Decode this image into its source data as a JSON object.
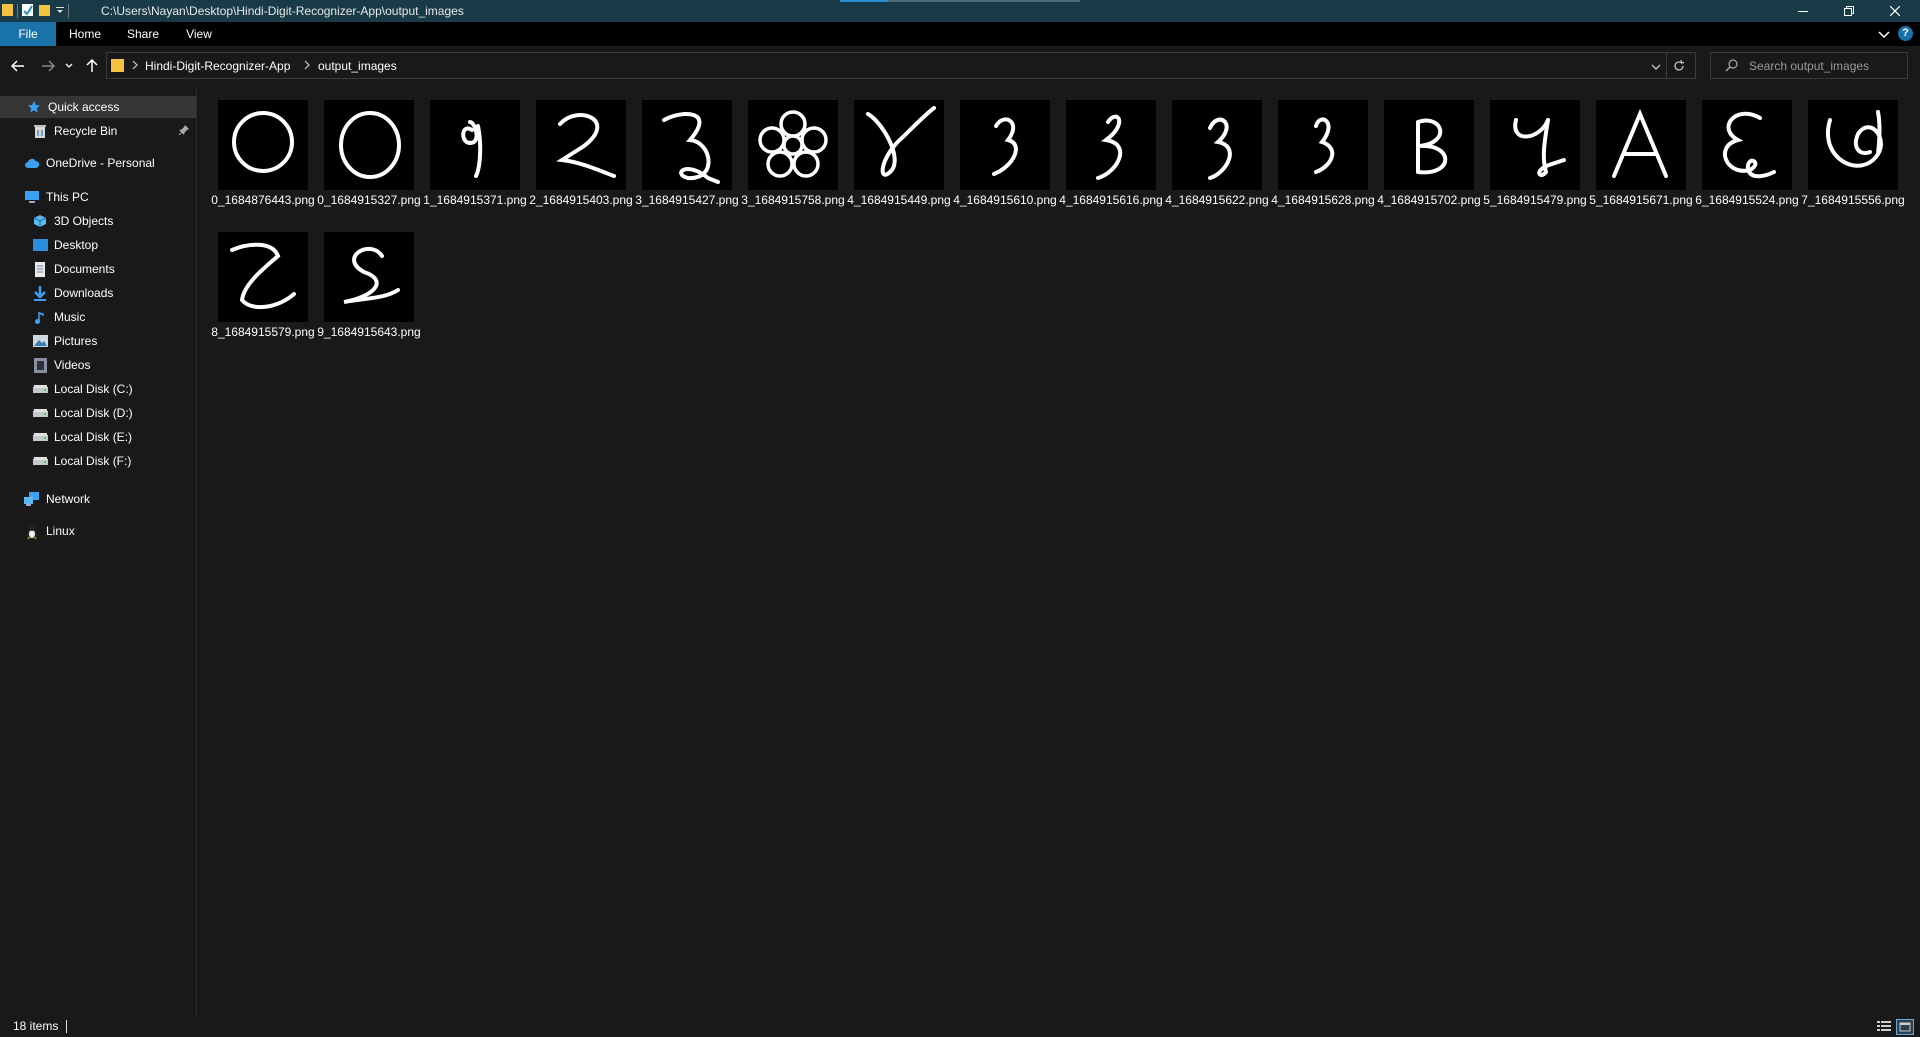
{
  "window": {
    "title": "C:\\Users\\Nayan\\Desktop\\Hindi-Digit-Recognizer-App\\output_images",
    "controls": [
      "minimize",
      "restore",
      "close"
    ]
  },
  "ribbon": {
    "tabs": [
      {
        "label": "File",
        "active": true
      },
      {
        "label": "Home"
      },
      {
        "label": "Share"
      },
      {
        "label": "View"
      }
    ]
  },
  "address": {
    "crumbs": [
      "Hindi-Digit-Recognizer-App",
      "output_images"
    ]
  },
  "search": {
    "placeholder": "Search output_images"
  },
  "sidebar": {
    "items": [
      {
        "label": "Quick access",
        "icon": "star-icon",
        "selected": true
      },
      {
        "label": "Recycle Bin",
        "icon": "recycle-bin-icon",
        "pinned": true
      },
      {
        "label": "OneDrive - Personal",
        "icon": "cloud-icon"
      },
      {
        "label": "This PC",
        "icon": "computer-icon"
      },
      {
        "label": "3D Objects",
        "icon": "cube-icon"
      },
      {
        "label": "Desktop",
        "icon": "desktop-icon"
      },
      {
        "label": "Documents",
        "icon": "document-icon"
      },
      {
        "label": "Downloads",
        "icon": "download-icon"
      },
      {
        "label": "Music",
        "icon": "music-icon"
      },
      {
        "label": "Pictures",
        "icon": "pictures-icon"
      },
      {
        "label": "Videos",
        "icon": "video-icon"
      },
      {
        "label": "Local Disk (C:)",
        "icon": "drive-icon"
      },
      {
        "label": "Local Disk (D:)",
        "icon": "drive-icon"
      },
      {
        "label": "Local Disk (E:)",
        "icon": "drive-icon"
      },
      {
        "label": "Local Disk (F:)",
        "icon": "drive-icon"
      },
      {
        "label": "Network",
        "icon": "network-icon"
      },
      {
        "label": "Linux",
        "icon": "linux-icon"
      }
    ]
  },
  "files": [
    {
      "name": "0_1684876443.png"
    },
    {
      "name": "0_1684915327.png"
    },
    {
      "name": "1_1684915371.png"
    },
    {
      "name": "2_1684915403.png"
    },
    {
      "name": "3_1684915427.png"
    },
    {
      "name": "3_1684915758.png"
    },
    {
      "name": "4_1684915449.png"
    },
    {
      "name": "4_1684915610.png"
    },
    {
      "name": "4_1684915616.png"
    },
    {
      "name": "4_1684915622.png"
    },
    {
      "name": "4_1684915628.png"
    },
    {
      "name": "4_1684915702.png"
    },
    {
      "name": "5_1684915479.png"
    },
    {
      "name": "5_1684915671.png"
    },
    {
      "name": "6_1684915524.png"
    },
    {
      "name": "7_1684915556.png"
    },
    {
      "name": "8_1684915579.png"
    },
    {
      "name": "9_1684915643.png"
    }
  ],
  "status": {
    "item_count": "18 items"
  },
  "colors": {
    "background": "#191919",
    "titlebar": "#193a47",
    "file_tab": "#1a73a8",
    "selected": "#363636",
    "folder": "#f5c344"
  }
}
